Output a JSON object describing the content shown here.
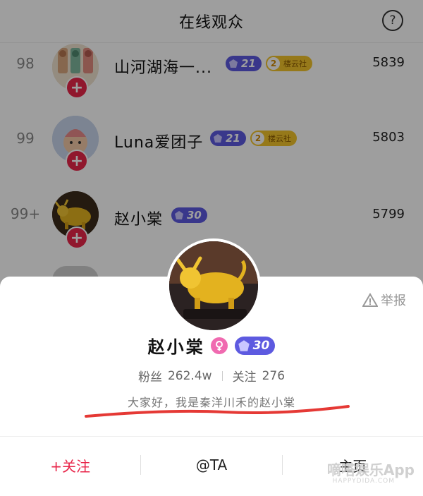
{
  "header": {
    "title": "在线观众",
    "help_glyph": "?"
  },
  "viewers": [
    {
      "rank": "98",
      "name": "山河湖海一...",
      "level": "21",
      "fan_badge_level": "2",
      "fan_badge_name": "楼云社",
      "score": "5839"
    },
    {
      "rank": "99",
      "name": "Luna爱团子",
      "level": "21",
      "fan_badge_level": "2",
      "fan_badge_name": "楼云社",
      "score": "5803"
    },
    {
      "rank": "99+",
      "name": "赵小棠",
      "level": "30",
      "score": "5799"
    }
  ],
  "profile": {
    "name": "赵小棠",
    "level": "30",
    "report_label": "举报",
    "fans_label": "粉丝",
    "fans_value": "262.4w",
    "follow_label": "关注",
    "follow_value": "276",
    "bio": "大家好，我是秦洋川禾的赵小棠"
  },
  "actions": {
    "follow": "+关注",
    "at": "@TA",
    "home": "主页"
  },
  "watermark": {
    "main": "嘀嗒娱乐App",
    "sub": "HAPPYDIDA.COM"
  },
  "colors": {
    "accent": "#e8264a",
    "level_badge": "#5d5ae0",
    "fan_badge": "#f2c42a",
    "female_icon": "#f06ab0",
    "underline_mark": "#e53935"
  }
}
